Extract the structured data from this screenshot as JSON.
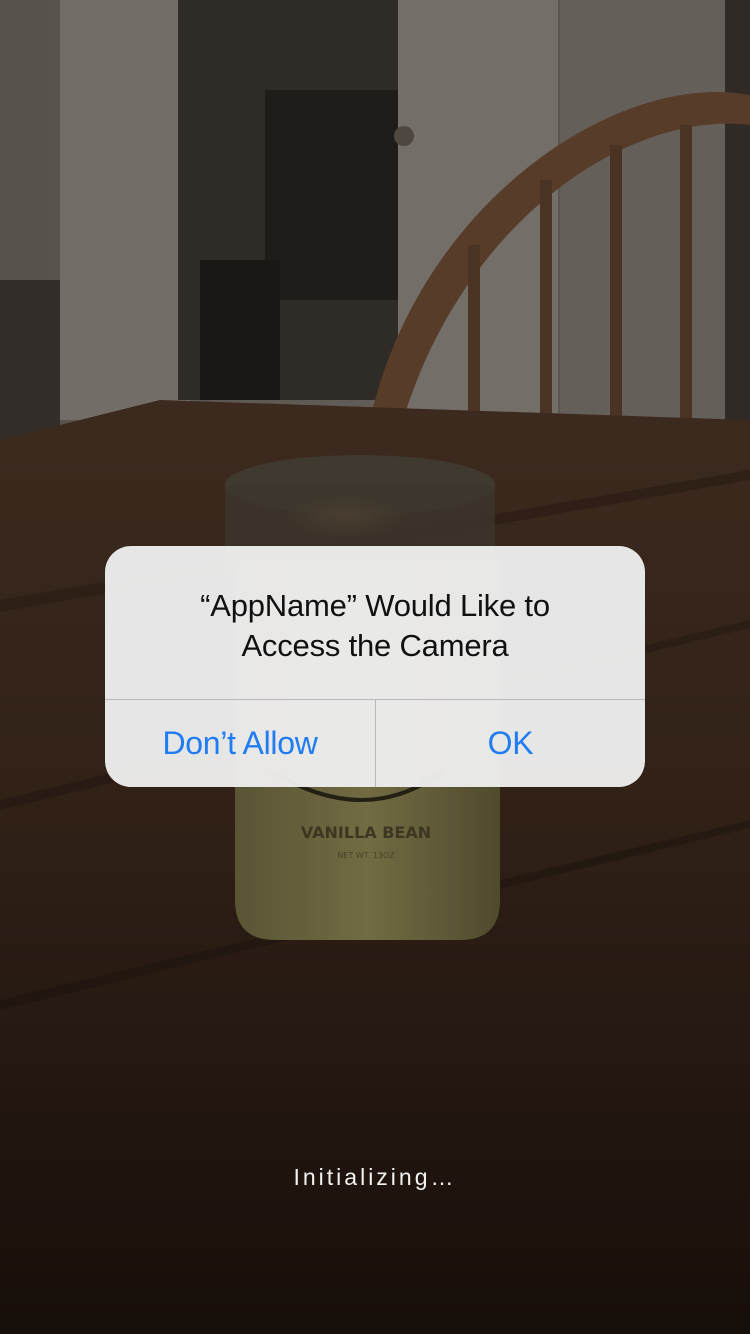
{
  "camera_feed": {
    "jar_label_text": "VANILLA BEAN",
    "jar_label_subtext": "NET WT. 13OZ"
  },
  "alert": {
    "title_line1": "“AppName” Would Like to",
    "title_line2": "Access the Camera",
    "dont_allow_label": "Don’t Allow",
    "ok_label": "OK"
  },
  "status": {
    "text": "Initializing…"
  },
  "colors": {
    "button_blue": "#1f7cf2",
    "alert_background": "#eeeeee",
    "status_text": "#f2f2f2"
  }
}
